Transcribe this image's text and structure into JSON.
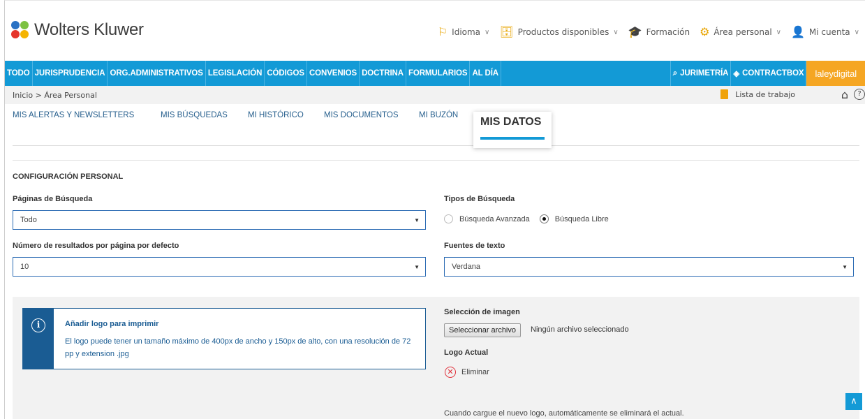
{
  "brand": {
    "name": "Wolters Kluwer"
  },
  "top_nav": [
    {
      "label": "Idioma",
      "icon": "flag-icon"
    },
    {
      "label": "Productos disponibles",
      "icon": "briefcase-icon"
    },
    {
      "label": "Formación",
      "icon": "graduation-cap-icon"
    },
    {
      "label": "Área personal",
      "icon": "gear-icon"
    },
    {
      "label": "Mi cuenta",
      "icon": "user-icon"
    }
  ],
  "main_nav": [
    "TODO",
    "JURISPRUDENCIA",
    "ORG.ADMINISTRATIVOS",
    "LEGISLACIÓN",
    "CÓDIGOS",
    "CONVENIOS",
    "DOCTRINA",
    "FORMULARIOS",
    "AL DÍA"
  ],
  "main_nav_right": {
    "jurimetria": "JURIMETRÍA",
    "contractbox": "CONTRACTBOX",
    "laleydigital": "laleydigital"
  },
  "breadcrumb": "Inicio > Área Personal",
  "worklist": "Lista de trabajo",
  "tabs": [
    "MIS ALERTAS Y NEWSLETTERS",
    "MIS BÚSQUEDAS",
    "MI HISTÓRICO",
    "MIS DOCUMENTOS",
    "MI BUZÓN"
  ],
  "active_tab": "MIS DATOS",
  "section_title": "CONFIGURACIÓN PERSONAL",
  "form": {
    "search_pages_label": "Páginas de Búsqueda",
    "search_pages_value": "Todo",
    "results_label": "Número de resultados por página por defecto",
    "results_value": "10",
    "search_types_label": "Tipos de Búsqueda",
    "radio_advanced": "Búsqueda Avanzada",
    "radio_free": "Búsqueda Libre",
    "fonts_label": "Fuentes de texto",
    "fonts_value": "Verdana"
  },
  "info_box": {
    "title": "Añadir logo para imprimir",
    "text": "El logo puede tener un tamaño máximo de 400px de ancho y 150px de alto, con una resolución de 72 pp y extension .jpg"
  },
  "image": {
    "label": "Selección de imagen",
    "button": "Seleccionar archivo",
    "no_file": "Ningún archivo seleccionado",
    "current_logo_label": "Logo Actual",
    "delete": "Eliminar",
    "note": "Cuando cargue el nuevo logo, automáticamente se eliminará el actual."
  },
  "colors": {
    "primary": "#139ad6",
    "accent": "#f5a623",
    "dark_blue": "#1a5c93",
    "danger": "#e0303a"
  }
}
